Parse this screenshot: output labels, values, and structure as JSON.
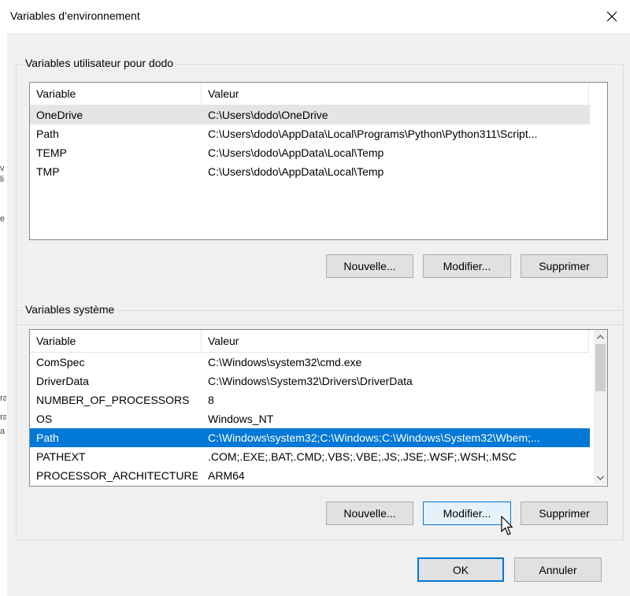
{
  "window": {
    "title": "Variables d’environnement",
    "close_icon": "close-icon"
  },
  "user_group": {
    "title": "Variables utilisateur pour dodo",
    "columns": [
      "Variable",
      "Valeur"
    ],
    "rows": [
      {
        "variable": "OneDrive",
        "value": "C:\\Users\\dodo\\OneDrive"
      },
      {
        "variable": "Path",
        "value": "C:\\Users\\dodo\\AppData\\Local\\Programs\\Python\\Python311\\Script..."
      },
      {
        "variable": "TEMP",
        "value": "C:\\Users\\dodo\\AppData\\Local\\Temp"
      },
      {
        "variable": "TMP",
        "value": "C:\\Users\\dodo\\AppData\\Local\\Temp"
      }
    ],
    "buttons": {
      "new": "Nouvelle...",
      "edit": "Modifier...",
      "delete": "Supprimer"
    }
  },
  "system_group": {
    "title": "Variables système",
    "columns": [
      "Variable",
      "Valeur"
    ],
    "rows": [
      {
        "variable": "ComSpec",
        "value": "C:\\Windows\\system32\\cmd.exe"
      },
      {
        "variable": "DriverData",
        "value": "C:\\Windows\\System32\\Drivers\\DriverData"
      },
      {
        "variable": "NUMBER_OF_PROCESSORS",
        "value": "8"
      },
      {
        "variable": "OS",
        "value": "Windows_NT"
      },
      {
        "variable": "Path",
        "value": "C:\\Windows\\system32;C:\\Windows;C:\\Windows\\System32\\Wbem;..."
      },
      {
        "variable": "PATHEXT",
        "value": ".COM;.EXE;.BAT;.CMD;.VBS;.VBE;.JS;.JSE;.WSF;.WSH;.MSC"
      },
      {
        "variable": "PROCESSOR_ARCHITECTURE",
        "value": "ARM64"
      }
    ],
    "selected_row": "Path",
    "buttons": {
      "new": "Nouvelle...",
      "edit": "Modifier...",
      "delete": "Supprimer"
    }
  },
  "footer": {
    "ok": "OK",
    "cancel": "Annuler"
  },
  "colors": {
    "selection": "#0078d7",
    "hover_row": "#e5e5e5",
    "dialog_bg": "#f0f0f0"
  },
  "background_glyphs": [
    "v",
    "li",
    "e",
    "ra",
    "ra",
    "a"
  ]
}
